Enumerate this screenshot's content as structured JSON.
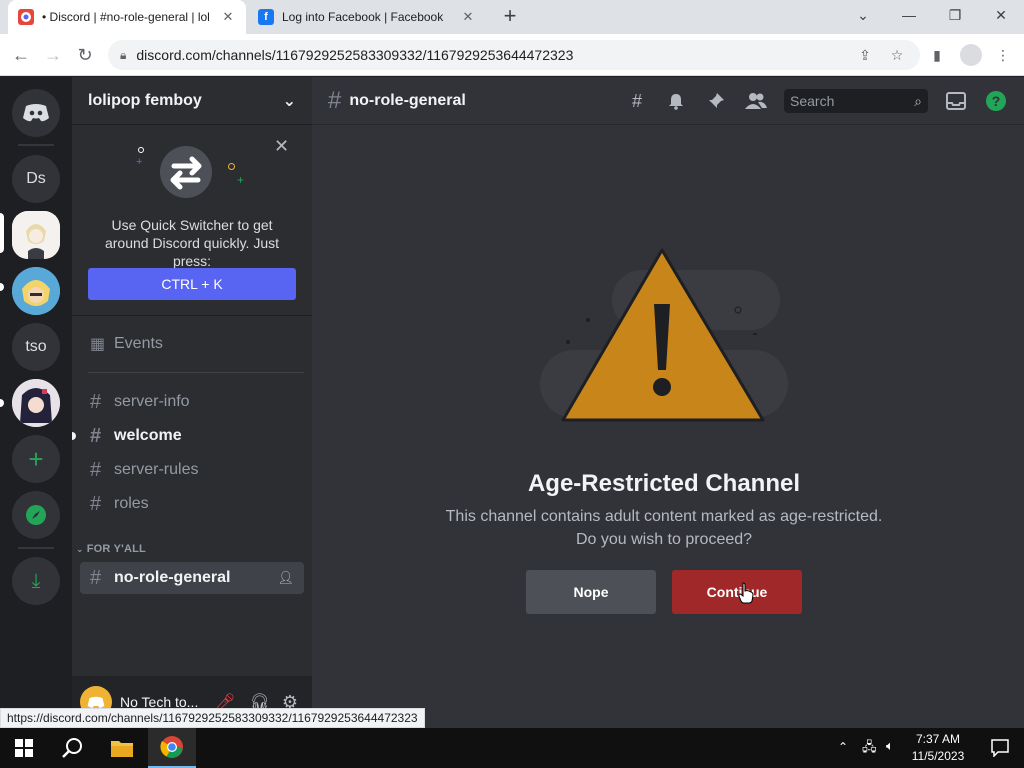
{
  "browser": {
    "tabs": [
      {
        "title": "• Discord | #no-role-general | lol",
        "close": "✕"
      },
      {
        "title": "Log into Facebook | Facebook",
        "close": "✕"
      }
    ],
    "new_tab": "+",
    "url": "discord.com/channels/1167929252583309332/1167929253644472323",
    "status_url": "https://discord.com/channels/1167929252583309332/1167929253644472323"
  },
  "guilds": {
    "items": [
      {
        "label": "Ds"
      },
      {
        "label": "tso"
      }
    ]
  },
  "sidebar": {
    "server_name": "lolipop femboy",
    "quick_switcher": {
      "text": "Use Quick Switcher to get around Discord quickly. Just press:",
      "shortcut": "CTRL + K"
    },
    "events_label": "Events",
    "channels": [
      {
        "name": "server-info"
      },
      {
        "name": "welcome"
      },
      {
        "name": "server-rules"
      },
      {
        "name": "roles"
      }
    ],
    "category": "FOR Y'ALL",
    "selected_channel": "no-role-general",
    "user_name": "No Tech to..."
  },
  "main": {
    "channel_title": "no-role-general",
    "search_placeholder": "Search",
    "age_title": "Age-Restricted Channel",
    "age_desc_line1": "This channel contains adult content marked as age-restricted.",
    "age_desc_line2": "Do you wish to proceed?",
    "nope_label": "Nope",
    "continue_label": "Continue"
  },
  "taskbar": {
    "time": "7:37 AM",
    "date": "11/5/2023"
  },
  "colors": {
    "discord_bg": "#313338",
    "sidebar_bg": "#2b2d31",
    "guild_bg": "#1e1f22",
    "blurple": "#5865f2",
    "warning_orange": "#c8851a",
    "continue_red": "#a12828",
    "green": "#23a559"
  }
}
